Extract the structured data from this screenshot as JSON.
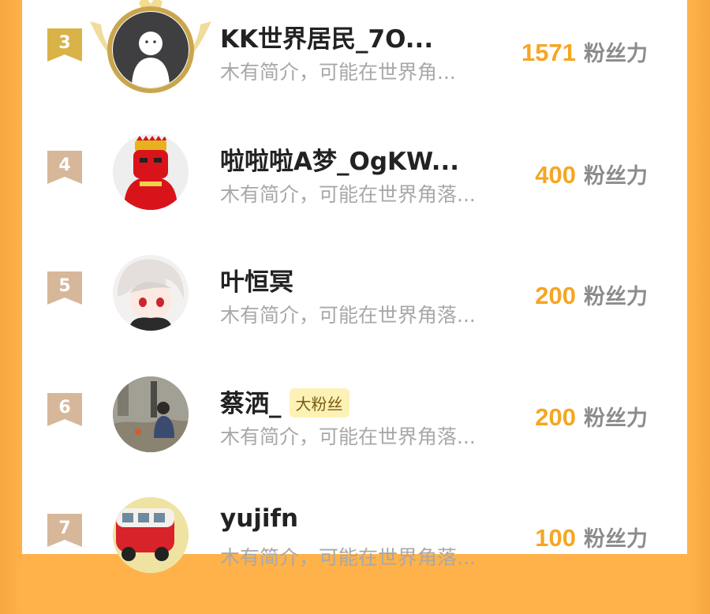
{
  "unit_label": "粉丝力",
  "colors": {
    "score": "#f6a623",
    "rank_gold": "#d9b347",
    "rank_tan": "#d7b79a",
    "frame_gold": "#c9a64e"
  },
  "rows": [
    {
      "rank": "3",
      "name": "KK世界居民_7O...",
      "desc": "木有简介，可能在世界角...",
      "score": "1571",
      "badge": "",
      "avatar": "default-avatar-icon"
    },
    {
      "rank": "4",
      "name": "啦啦啦A梦_OgKW...",
      "desc": "木有简介，可能在世界角落...",
      "score": "400",
      "badge": "",
      "avatar": "red-mascot-avatar"
    },
    {
      "rank": "5",
      "name": "叶恒冥",
      "desc": "木有简介，可能在世界角落...",
      "score": "200",
      "badge": "",
      "avatar": "anime-character-avatar"
    },
    {
      "rank": "6",
      "name": "蔡洒_",
      "desc": "木有简介，可能在世界角落...",
      "score": "200",
      "badge": "大粉丝",
      "avatar": "photo-person-avatar"
    },
    {
      "rank": "7",
      "name": "yujifn",
      "desc": "木有简介，可能在世界角落...",
      "score": "100",
      "badge": "",
      "avatar": "red-bus-avatar"
    }
  ]
}
